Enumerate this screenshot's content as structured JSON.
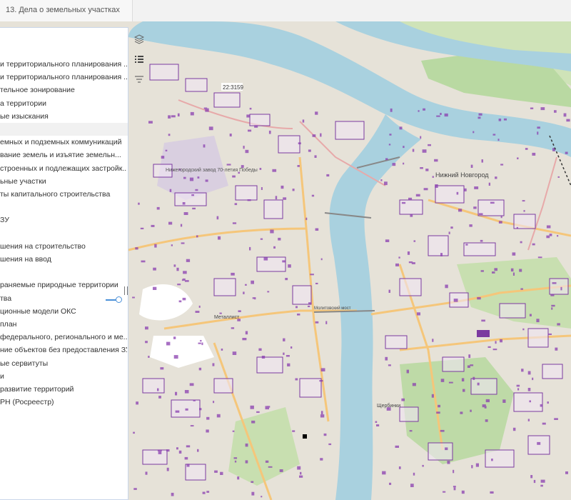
{
  "tab": {
    "title": "13. Дела о земельных участках"
  },
  "map": {
    "labels": {
      "cadastral_number": "22:3159",
      "zavod": "Нижегородский завод 70-летия Победы",
      "nizhny": "Нижний Новгород",
      "bridge": "Молитовский мост",
      "shcherbinki": "Щербинки",
      "metalist": "Металлист"
    },
    "colors": {
      "water": "#a9d1df",
      "land": "#e6e2d8",
      "parcel": "#7b3aa0",
      "green": "#b9d9a2",
      "road": "#f5c67a"
    }
  },
  "toolbar": {
    "icons": [
      "layers-icon",
      "list-icon",
      "filter-icon"
    ]
  },
  "layers": [
    "и территориального планирования ...",
    "и территориального планирования ...",
    "тельное зонирование",
    "а территории",
    "ые изыскания",
    "",
    "емных и подземных коммуникаций",
    "вание земель и изъятие земельн...",
    "строенных и подлежащих застройк...",
    "ьные участки",
    "ты капитального строительства",
    "",
    "ЗУ",
    "",
    "шения на строительство",
    "шения на ввод",
    "",
    "раняемые природные территории",
    "тва",
    "ционные модели ОКС",
    "план",
    "федерального, регионального и ме...",
    "ние объектов без предоставления ЗУ",
    "ые сервитуты",
    "и",
    "развитие территорий",
    "РН (Росреестр)"
  ]
}
